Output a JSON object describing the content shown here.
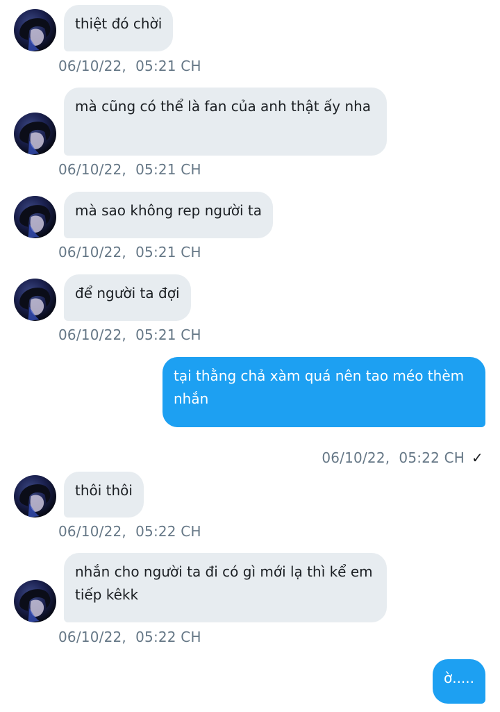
{
  "chat": {
    "messages": [
      {
        "direction": "in",
        "text": "thiệt đó chời",
        "time": "06/10/22,  05:21 CH"
      },
      {
        "direction": "in",
        "text": "mà cũng có thể là fan của anh thật ấy nha",
        "time": "06/10/22,  05:21 CH"
      },
      {
        "direction": "in",
        "text": "mà sao không rep người ta",
        "time": "06/10/22,  05:21 CH"
      },
      {
        "direction": "in",
        "text": "để người ta đợi",
        "time": "06/10/22,  05:21 CH"
      },
      {
        "direction": "out",
        "text": "tại thằng chả xàm quá nên tao méo thèm nhắn",
        "time": "06/10/22,  05:22 CH",
        "status_icon": "check-icon",
        "status_glyph": "✓"
      },
      {
        "direction": "in",
        "text": "thôi thôi",
        "time": "06/10/22,  05:22 CH"
      },
      {
        "direction": "in",
        "text": "nhắn cho người ta đi có gì mới lạ thì kể em tiếp kêkk",
        "time": "06/10/22,  05:22 CH"
      },
      {
        "direction": "out",
        "text": "ờ.....",
        "time": ""
      }
    ]
  },
  "colors": {
    "incoming_bubble": "#e7ecf0",
    "outgoing_bubble": "#1da0f2",
    "timestamp": "#657786",
    "text": "#1b1f23"
  }
}
